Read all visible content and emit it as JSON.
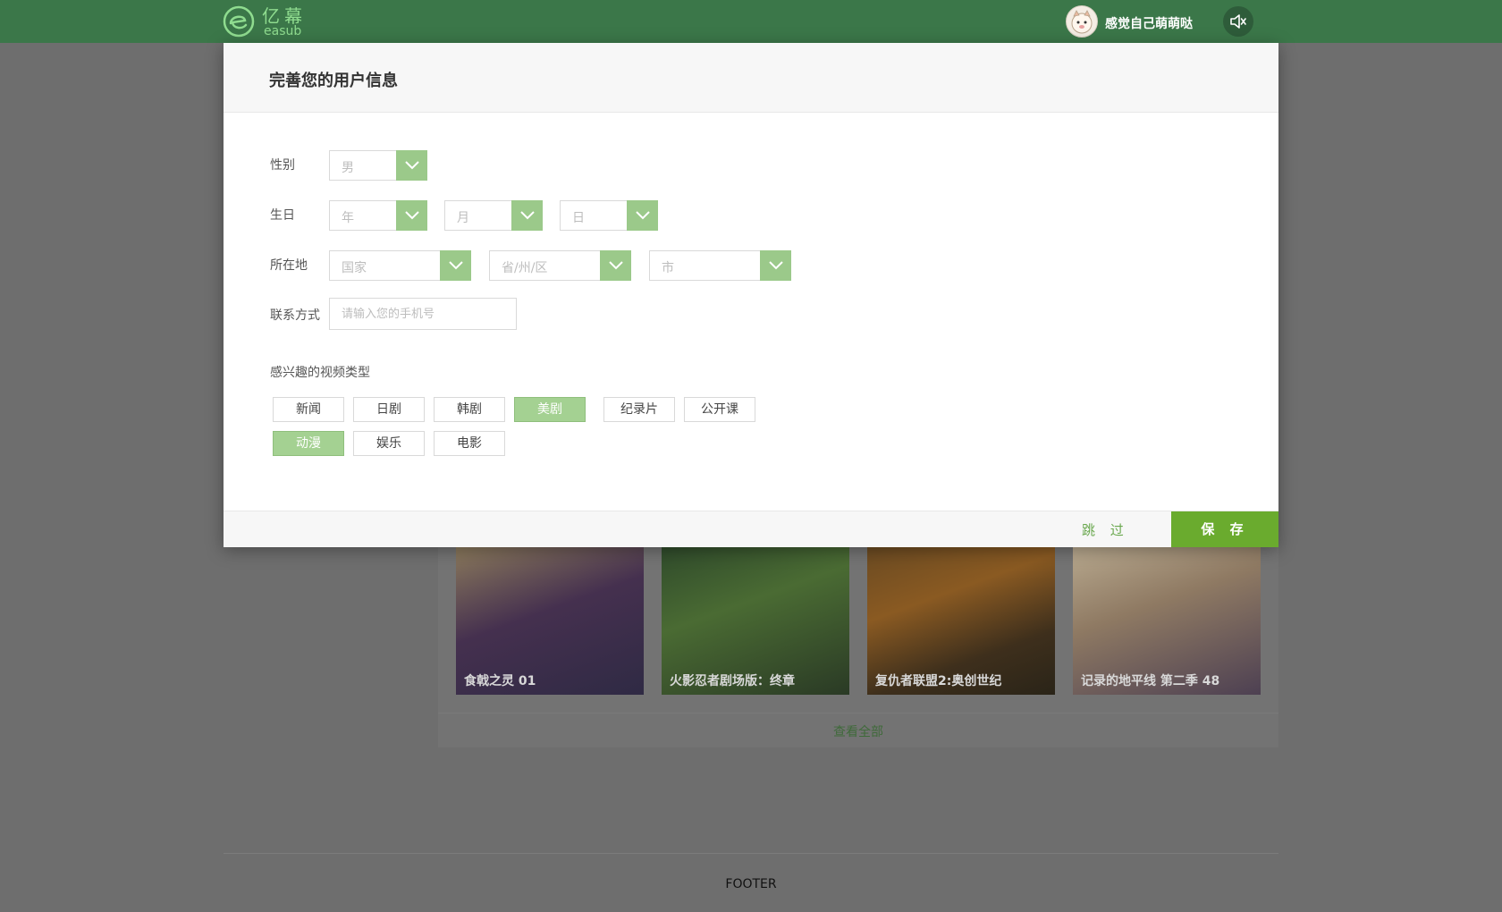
{
  "header": {
    "logo_cn": "亿幕",
    "logo_en": "easub",
    "username": "感觉自己萌萌哒"
  },
  "modal": {
    "title": "完善您的用户信息",
    "gender": {
      "label": "性别",
      "value": "男"
    },
    "birthday": {
      "label": "生日",
      "year": "年",
      "month": "月",
      "day": "日"
    },
    "location": {
      "label": "所在地",
      "country": "国家",
      "province": "省/州/区",
      "city": "市"
    },
    "contact": {
      "label": "联系方式",
      "placeholder": "请输入您的手机号"
    },
    "interests": {
      "label": "感兴趣的视频类型",
      "tags": [
        {
          "label": "新闻",
          "selected": false
        },
        {
          "label": "日剧",
          "selected": false
        },
        {
          "label": "韩剧",
          "selected": false
        },
        {
          "label": "美剧",
          "selected": true
        },
        {
          "label": "纪录片",
          "selected": false
        },
        {
          "label": "公开课",
          "selected": false
        },
        {
          "label": "动漫",
          "selected": true
        },
        {
          "label": "娱乐",
          "selected": false
        },
        {
          "label": "电影",
          "selected": false
        }
      ]
    },
    "skip_label": "跳 过",
    "save_label": "保 存"
  },
  "background": {
    "videos": [
      {
        "title": "食戟之灵 01"
      },
      {
        "title": "火影忍者剧场版：终章"
      },
      {
        "title": "复仇者联盟2:奥创世纪"
      },
      {
        "title": "记录的地平线 第二季 48"
      }
    ],
    "view_all": "查看全部",
    "footer": "FOOTER"
  },
  "colors": {
    "topbar": "#3b7749",
    "accent_green": "#6aab2e",
    "selected_tag": "#a4d192",
    "select_arrow": "#9bc98a"
  }
}
